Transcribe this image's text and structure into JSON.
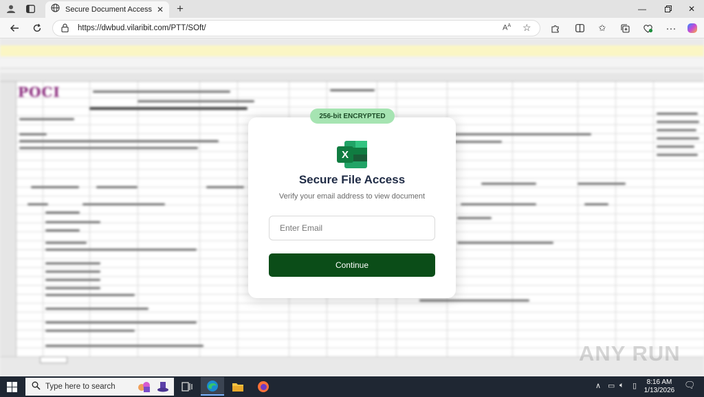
{
  "browser": {
    "tab_title": "Secure Document Access",
    "url": "https://dwbud.vilaribit.com/PTT/SOft/"
  },
  "modal": {
    "badge": "256-bit ENCRYPTED",
    "title": "Secure File Access",
    "subtitle": "Verify your email address to view document",
    "email_placeholder": "Enter Email",
    "email_value": "",
    "button_label": "Continue"
  },
  "background_sheet": {
    "logo_text": "POCI"
  },
  "watermark": "ANY RUN",
  "taskbar": {
    "search_placeholder": "Type here to search",
    "time": "8:16 AM",
    "date": "1/13/2026"
  },
  "colors": {
    "badge_bg": "#a6e4b2",
    "button_bg": "#0b4d18",
    "title_color": "#1f2b45",
    "excel_green": "#1d6f42"
  },
  "icons": {
    "tab": "globe-icon",
    "back": "back-arrow-icon",
    "refresh": "refresh-icon",
    "lock": "lock-icon",
    "read_aloud": "read-aloud-icon",
    "favorite": "star-icon",
    "extensions": "puzzle-icon",
    "split": "split-screen-icon",
    "favorites_bar": "favorites-icon",
    "collections": "collections-icon",
    "browser_essentials": "heart-pulse-icon",
    "more": "more-icon",
    "copilot": "copilot-icon",
    "excel": "excel-icon"
  }
}
